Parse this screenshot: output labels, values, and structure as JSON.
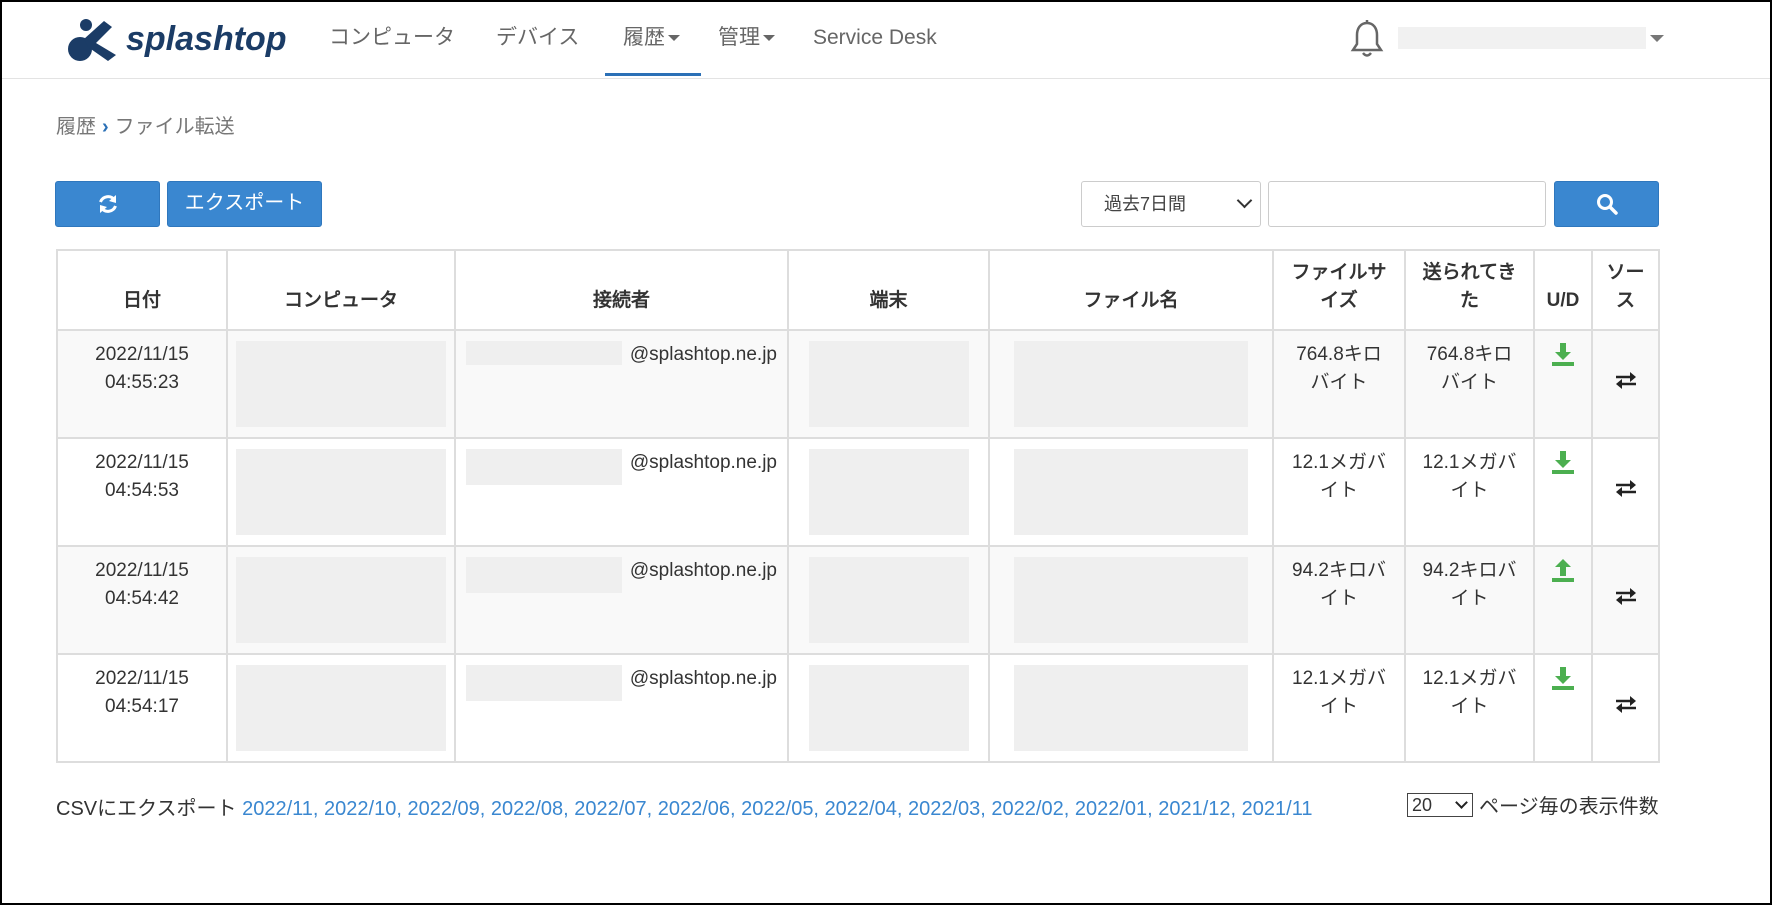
{
  "brand": {
    "name": "splashtop",
    "color": "#1b3c66",
    "accent": "#3a87d0"
  },
  "nav": {
    "computers": "コンピュータ",
    "devices": "デバイス",
    "history": "履歴",
    "manage": "管理",
    "service_desk": "Service Desk"
  },
  "breadcrumb": {
    "parent": "履歴",
    "current": "ファイル転送"
  },
  "toolbar": {
    "export_label": "エクスポート",
    "range_selected": "過去7日間",
    "search_value": ""
  },
  "table": {
    "headers": {
      "date": "日付",
      "computer": "コンピュータ",
      "connector": "接続者",
      "terminal": "端末",
      "file_name": "ファイル名",
      "file_size_1": "ファイルサ",
      "file_size_2": "イズ",
      "sent_1": "送られてき",
      "sent_2": "た",
      "ud": "U/D",
      "source_1": "ソー",
      "source_2": "ス"
    },
    "rows": [
      {
        "date": "2022/11/15",
        "time": "04:55:23",
        "email": "@splashtop.ne.jp",
        "size_1": "764.8キロ",
        "size_2": "バイト",
        "sent_1": "764.8キロ",
        "sent_2": "バイト",
        "direction": "download"
      },
      {
        "date": "2022/11/15",
        "time": "04:54:53",
        "email": "@splashtop.ne.jp",
        "size_1": "12.1メガバ",
        "size_2": "イト",
        "sent_1": "12.1メガバ",
        "sent_2": "イト",
        "direction": "download"
      },
      {
        "date": "2022/11/15",
        "time": "04:54:42",
        "email": "@splashtop.ne.jp",
        "size_1": "94.2キロバ",
        "size_2": "イト",
        "sent_1": "94.2キロバ",
        "sent_2": "イト",
        "direction": "upload"
      },
      {
        "date": "2022/11/15",
        "time": "04:54:17",
        "email": "@splashtop.ne.jp",
        "size_1": "12.1メガバ",
        "size_2": "イト",
        "sent_1": "12.1メガバ",
        "sent_2": "イト",
        "direction": "download"
      }
    ]
  },
  "footer": {
    "csv_label": "CSVにエクスポート",
    "months": [
      "2022/11,",
      "2022/10,",
      "2022/09,",
      "2022/08,",
      "2022/07,",
      "2022/06,",
      "2022/05,",
      "2022/04,",
      "2022/03,",
      "2022/02,",
      "2022/01,",
      "2021/12,",
      "2021/11"
    ],
    "per_page_value": "20",
    "per_page_label": "ページ毎の表示件数"
  }
}
